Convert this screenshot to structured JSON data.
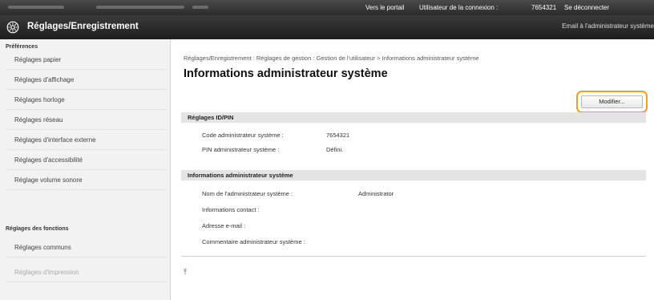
{
  "topbar": {
    "portal_link": "Vers le portail",
    "login_user_label": "Utilisateur de la connexion :",
    "login_user_value": "7654321",
    "logout_link": "Se déconnecter"
  },
  "header": {
    "title": "Réglages/Enregistrement",
    "email_link": "Email à l'administrateur système"
  },
  "sidebar": {
    "groups": [
      {
        "label": "Préférences",
        "items": [
          "Réglages papier",
          "Réglages d'affichage",
          "Réglages horloge",
          "Réglages réseau",
          "Réglages d'interface externe",
          "Réglages d'accessibilité",
          "Réglage volume sonore"
        ]
      },
      {
        "label": "Réglages des fonctions",
        "items": [
          "Réglages communs",
          "Réglages d'impression"
        ]
      }
    ]
  },
  "main": {
    "breadcrumb": "Réglages/Enregistrement : Réglages de gestion : Gestion de l'utilisateur > Informations administrateur système",
    "page_title": "Informations administrateur système",
    "edit_button": "Modifier...",
    "sections": [
      {
        "title": "Réglages ID/PIN",
        "rows": [
          {
            "label": "Code administrateur système :",
            "value": "7654321"
          },
          {
            "label": "PIN administrateur système :",
            "value": "Défini."
          }
        ]
      },
      {
        "title": "Informations administrateur système",
        "rows": [
          {
            "label": "Nom de l'administrateur système :",
            "value": "Administrator"
          },
          {
            "label": "Informations contact :",
            "value": ""
          },
          {
            "label": "Adresse e-mail :",
            "value": ""
          },
          {
            "label": "Commentaire administrateur système :",
            "value": ""
          }
        ]
      }
    ]
  },
  "colors": {
    "header_bg": "#2b2b2b",
    "sidebar_bg": "#f2f2f2",
    "section_header_bg": "#e4e4e4",
    "highlight": "#f0a020"
  }
}
